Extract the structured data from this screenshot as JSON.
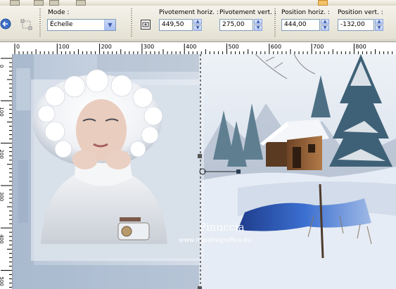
{
  "tool_options": {
    "mode_label": "Mode :",
    "mode_value": "Échelle",
    "pivot_x_label": "Pivotement horiz. :",
    "pivot_x_value": "449,50",
    "pivot_y_label": "Pivotement vert. :",
    "pivot_y_value": "275,00",
    "pos_x_label": "Position horiz. :",
    "pos_x_value": "444,00",
    "pos_y_label": "Position vert. :",
    "pos_y_value": "-132,00"
  },
  "ruler": {
    "top_labels": [
      "0",
      "100",
      "200",
      "300",
      "400",
      "500",
      "600",
      "700",
      "800"
    ],
    "left_labels": [
      "0",
      "100",
      "200",
      "300",
      "400",
      "500"
    ]
  },
  "canvas": {
    "watermark_name": "Pinuccia",
    "watermark_url": "www.maidiregrafica.eu"
  },
  "icons": {
    "back": "back-arrow-icon",
    "deform": "deform-tool-icon",
    "pivot": "pivot-frame-icon"
  }
}
